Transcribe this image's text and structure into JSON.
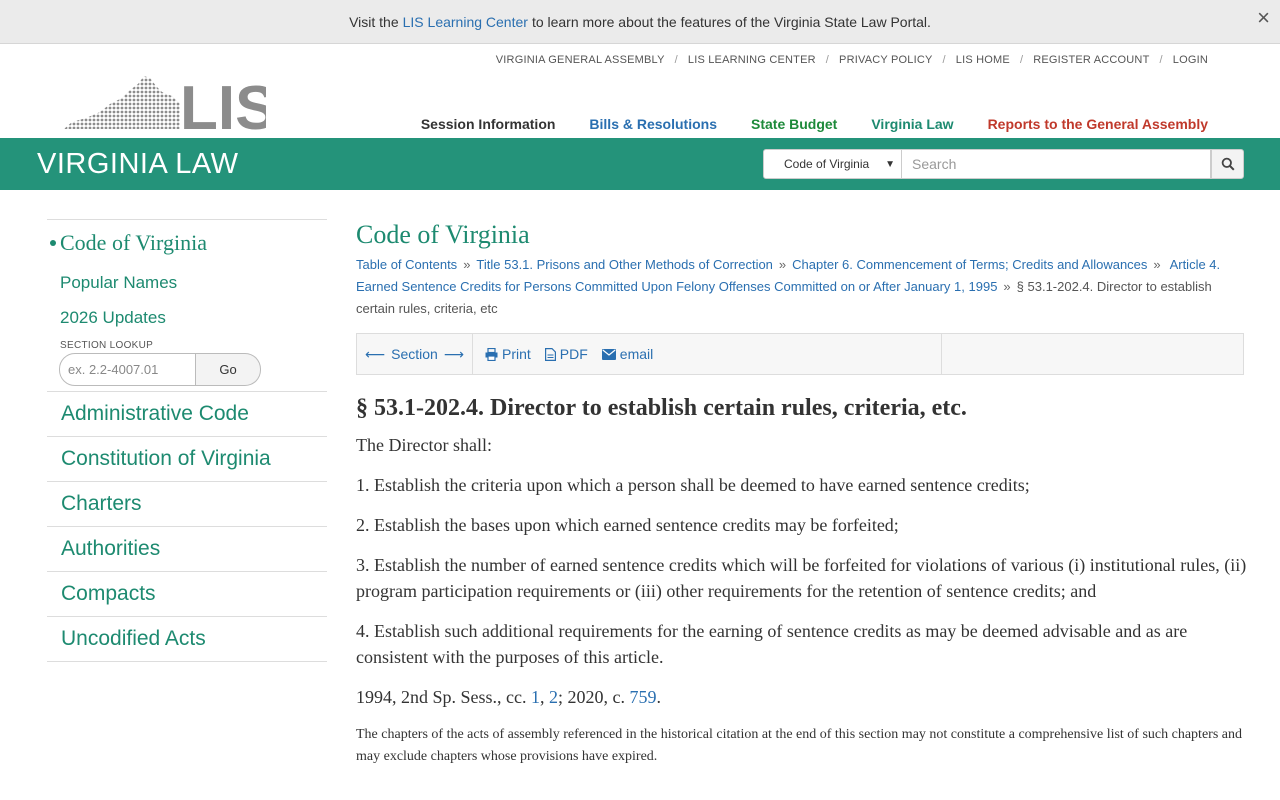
{
  "notice": {
    "prefix": "Visit the",
    "link": "LIS Learning Center",
    "suffix": "to learn more about the features of the Virginia State Law Portal.",
    "close": "×"
  },
  "util_links": [
    "VIRGINIA GENERAL ASSEMBLY",
    "LIS LEARNING CENTER",
    "PRIVACY POLICY",
    "LIS HOME",
    "REGISTER ACCOUNT",
    "LOGIN"
  ],
  "logo_text": "LIS",
  "main_nav": [
    {
      "label": "Session Information",
      "color": "#333333"
    },
    {
      "label": "Bills & Resolutions",
      "color": "#2a6fb0"
    },
    {
      "label": "State Budget",
      "color": "#1d8a3a"
    },
    {
      "label": "Virginia Law",
      "color": "#1d8a70"
    },
    {
      "label": "Reports to the General Assembly",
      "color": "#c0392b"
    }
  ],
  "band": {
    "title": "VIRGINIA LAW",
    "select_value": "Code of Virginia",
    "search_placeholder": "Search",
    "color": "#24937a"
  },
  "sidebar": {
    "code_label": "Code of Virginia",
    "sub_items": [
      "Popular Names",
      "2026 Updates"
    ],
    "lookup_label": "SECTION LOOKUP",
    "lookup_placeholder": "ex. 2.2-4007.01",
    "go_label": "Go",
    "items": [
      "Administrative Code",
      "Constitution of Virginia",
      "Charters",
      "Authorities",
      "Compacts",
      "Uncodified Acts"
    ]
  },
  "main": {
    "title": "Code of Virginia",
    "breadcrumbs": [
      "Table of Contents",
      "Title 53.1. Prisons and Other Methods of Correction",
      "Chapter 6. Commencement of Terms; Credits and Allowances",
      "Article 4. Earned Sentence Credits for Persons Committed Upon Felony Offenses Committed on or After January 1, 1995"
    ],
    "current_crumb": "§ 53.1-202.4. Director to establish certain rules, criteria, etc",
    "toolbar": {
      "section": "Section",
      "print": "Print",
      "pdf": "PDF",
      "email": "email"
    },
    "section_heading": "§ 53.1-202.4. Director to establish certain rules, criteria, etc.",
    "intro": "The Director shall:",
    "items": [
      "1. Establish the criteria upon which a person shall be deemed to have earned sentence credits;",
      "2. Establish the bases upon which earned sentence credits may be forfeited;",
      "3. Establish the number of earned sentence credits which will be forfeited for violations of various (i) institutional rules, (ii) program participation requirements or (iii) other requirements for the retention of sentence credits; and",
      "4. Establish such additional requirements for the earning of sentence credits as may be deemed advisable and as are consistent with the purposes of this article."
    ],
    "history": {
      "prefix": "1994, 2nd Sp. Sess., cc.",
      "link1": "1",
      "comma": ",",
      "link2": "2",
      "middle": "; 2020, c.",
      "link3": "759",
      "end": "."
    },
    "footnote": "The chapters of the acts of assembly referenced in the historical citation at the end of this section may not constitute a comprehensive list of such chapters and may exclude chapters whose provisions have expired."
  }
}
